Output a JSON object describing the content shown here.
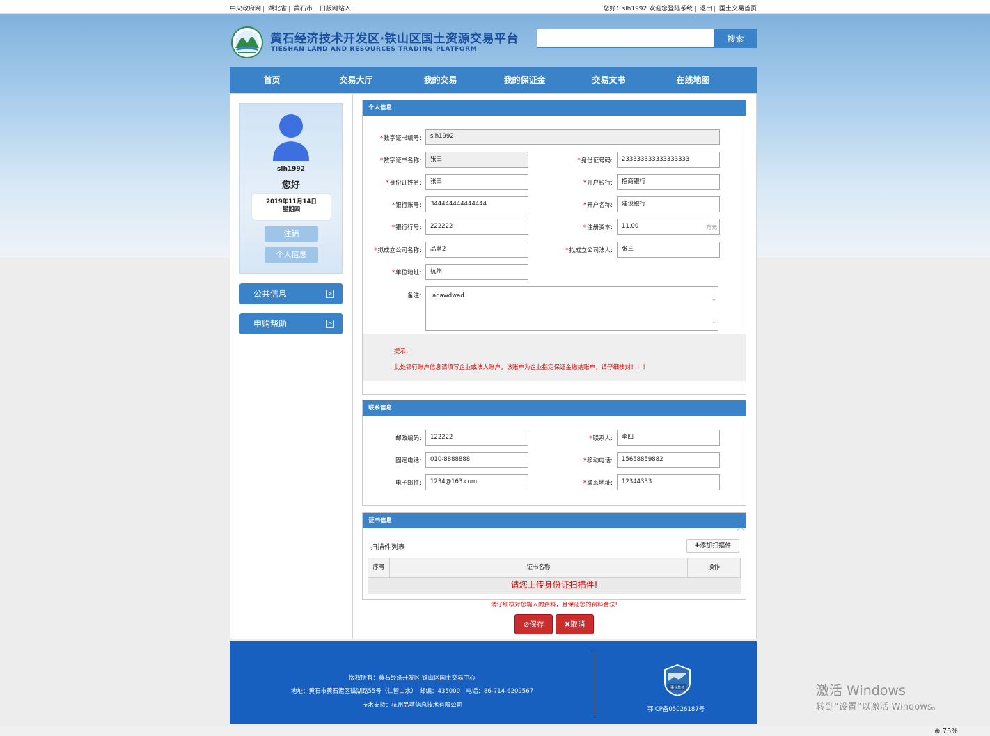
{
  "topbar": {
    "links": [
      "中央政府网",
      "湖北省",
      "黄石市",
      "旧版网站入口"
    ],
    "greeting": "您好：slh1992 欢迎您登陆系统",
    "logout": "退出",
    "home": "国土交易首页"
  },
  "header": {
    "title": "黄石经济技术开发区·铁山区国土资源交易平台",
    "subtitle": "TIESHAN LAND AND RESOURCES TRADING PLATFORM",
    "search_button": "搜索",
    "search_value": ""
  },
  "nav": [
    "首页",
    "交易大厅",
    "我的交易",
    "我的保证金",
    "交易文书",
    "在线地图"
  ],
  "profile": {
    "username": "slh1992",
    "hello": "您好",
    "date": "2019年11月14日",
    "weekday": "星期四",
    "logout_btn": "注销",
    "info_btn": "个人信息"
  },
  "side_menu": [
    "公共信息",
    "申购帮助"
  ],
  "personal": {
    "title": "个人信息",
    "cert_no_label": "数字证书编号:",
    "cert_no": "slh1992",
    "cert_name_label": "数字证书名称:",
    "cert_name": "张三",
    "id_no_label": "身份证号码:",
    "id_no": "233333333333333333",
    "id_name_label": "身份证姓名:",
    "id_name": "张三",
    "bank_label": "开户银行:",
    "bank": "招商银行",
    "account_label": "银行账号:",
    "account": "344444444444444",
    "account_name_label": "开户名称:",
    "account_name": "建设银行",
    "bank_code_label": "银行行号:",
    "bank_code": "222222",
    "capital_label": "注册资本:",
    "capital": "11.00",
    "capital_unit": "万元",
    "company_label": "拟成立公司名称:",
    "company": "品茗2",
    "legal_label": "拟成立公司法人:",
    "legal": "张三",
    "address_label": "单位地址:",
    "address": "杭州",
    "remark_label": "备注:",
    "remark": "adawdwad",
    "tip_title": "提示:",
    "tip_text": "此处银行账户信息请填写企业或法人账户，该账户为企业指定保证金缴纳账户，请仔细核对！！！"
  },
  "contact": {
    "title": "联系信息",
    "zip_label": "邮政编码:",
    "zip": "122222",
    "person_label": "联系人:",
    "person": "李四",
    "phone_label": "固定电话:",
    "phone": "010-8888888",
    "mobile_label": "移动电话:",
    "mobile": "15658859882",
    "email_label": "电子邮件:",
    "email": "1234@163.com",
    "addr_label": "联系地址:",
    "addr": "12344333"
  },
  "cert": {
    "title": "证书信息",
    "scan_list": "扫描件列表",
    "add_btn": "添加扫描件",
    "col_no": "序号",
    "col_name": "证书名称",
    "col_op": "操作",
    "empty": "请您上传身份证扫描件!"
  },
  "form": {
    "warning": "请仔细核对您输入的资料，且保证您的资料合法!",
    "save": "保存",
    "cancel": "取消"
  },
  "footer": {
    "copyright": "版权所有：黄石经济开发区·铁山区国土交易中心",
    "address": "地址：黄石市黄石港区磁湖路55号（仁智山水）　邮编：435000　电话：86-714-6209567",
    "support": "技术支持：杭州品茗信息技术有限公司",
    "badge": "事业单位",
    "icp": "鄂ICP备05026187号"
  },
  "overlay": {
    "activate_title": "激活 Windows",
    "activate_sub": "转到“设置”以激活 Windows。"
  },
  "statusbar": {
    "zoom": "75%"
  },
  "colors": {
    "primary": "#3a83c9",
    "footer": "#1760bf",
    "danger": "#c82e2e",
    "title": "#1a4e9c"
  }
}
